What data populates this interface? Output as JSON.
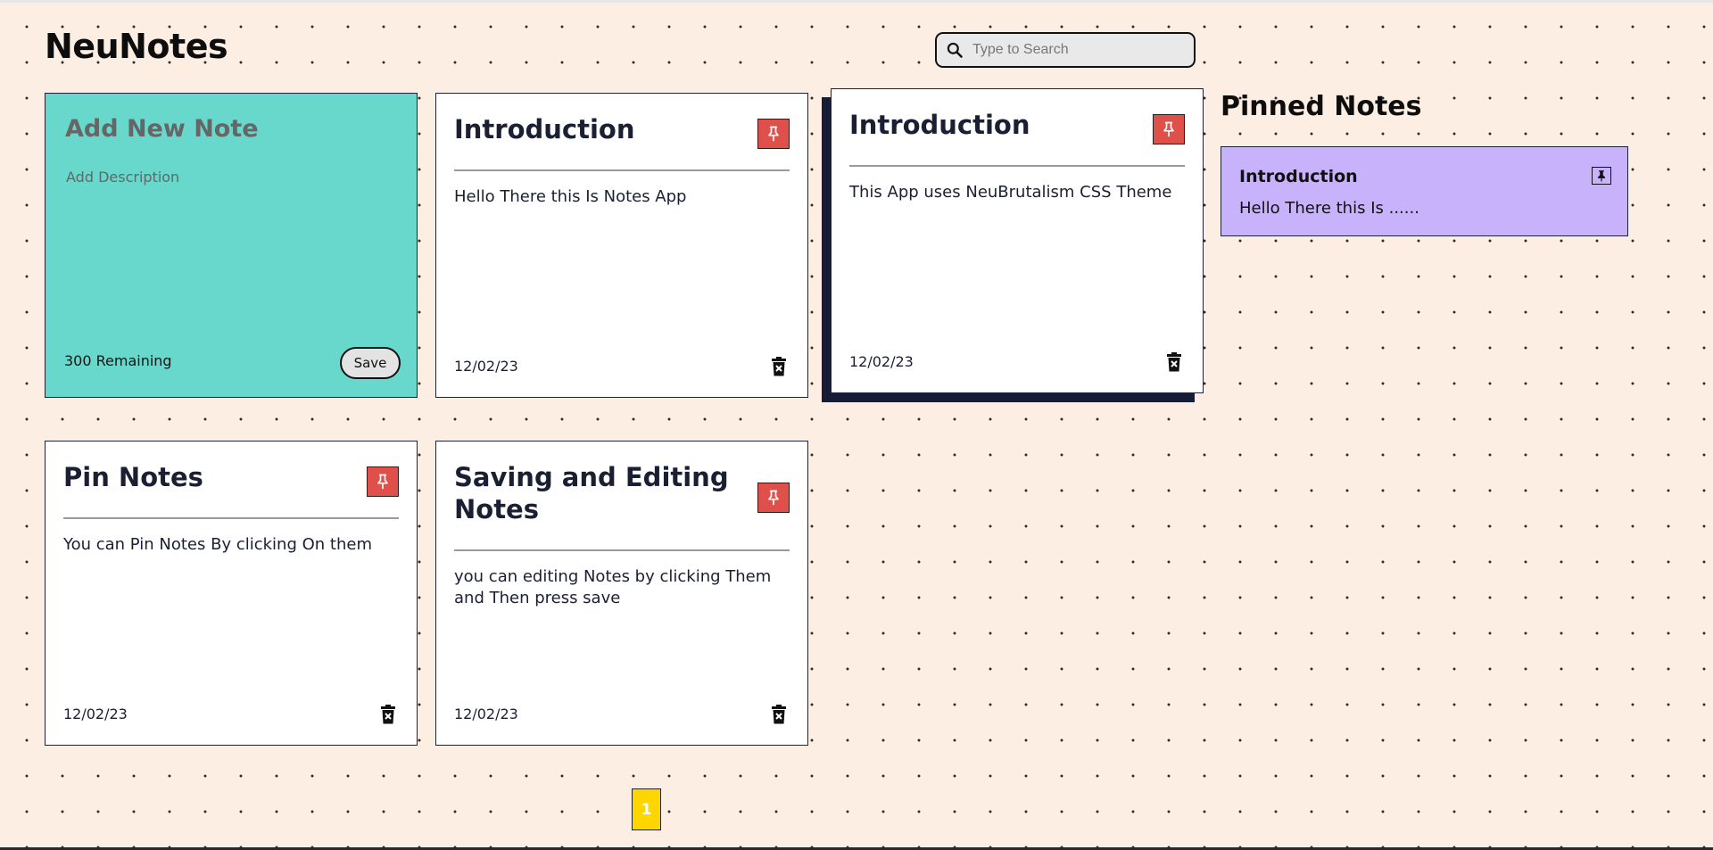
{
  "app": {
    "title": "NeuNotes"
  },
  "search": {
    "placeholder": "Type to Search",
    "icon": "search-icon"
  },
  "new_note": {
    "title_placeholder": "Add New Note",
    "description_placeholder": "Add Description",
    "remaining_text": "300 Remaining",
    "save_label": "Save",
    "background": "#69d8cc"
  },
  "notes": [
    {
      "title": "Introduction",
      "description": "Hello There this Is Notes App",
      "date": "12/02/23"
    },
    {
      "title": "Introduction",
      "description": "This App uses NeuBrutalism CSS Theme",
      "date": "12/02/23"
    },
    {
      "title": "Pin Notes",
      "description": "You can Pin Notes By clicking On them",
      "date": "12/02/23"
    },
    {
      "title": "Saving and Editing Notes",
      "description": "you can editing Notes by clicking Them and Then press save",
      "date": "12/02/23"
    }
  ],
  "pinned": {
    "heading": "Pinned Notes",
    "items": [
      {
        "title": "Introduction",
        "description": "Hello There this Is ......"
      }
    ],
    "background": "#c8b2fc"
  },
  "pagination": {
    "current": "1"
  },
  "colors": {
    "background": "#fdeee3",
    "pin_button": "#e0504a",
    "page_button": "#ffd500",
    "border": "#1d2238"
  }
}
